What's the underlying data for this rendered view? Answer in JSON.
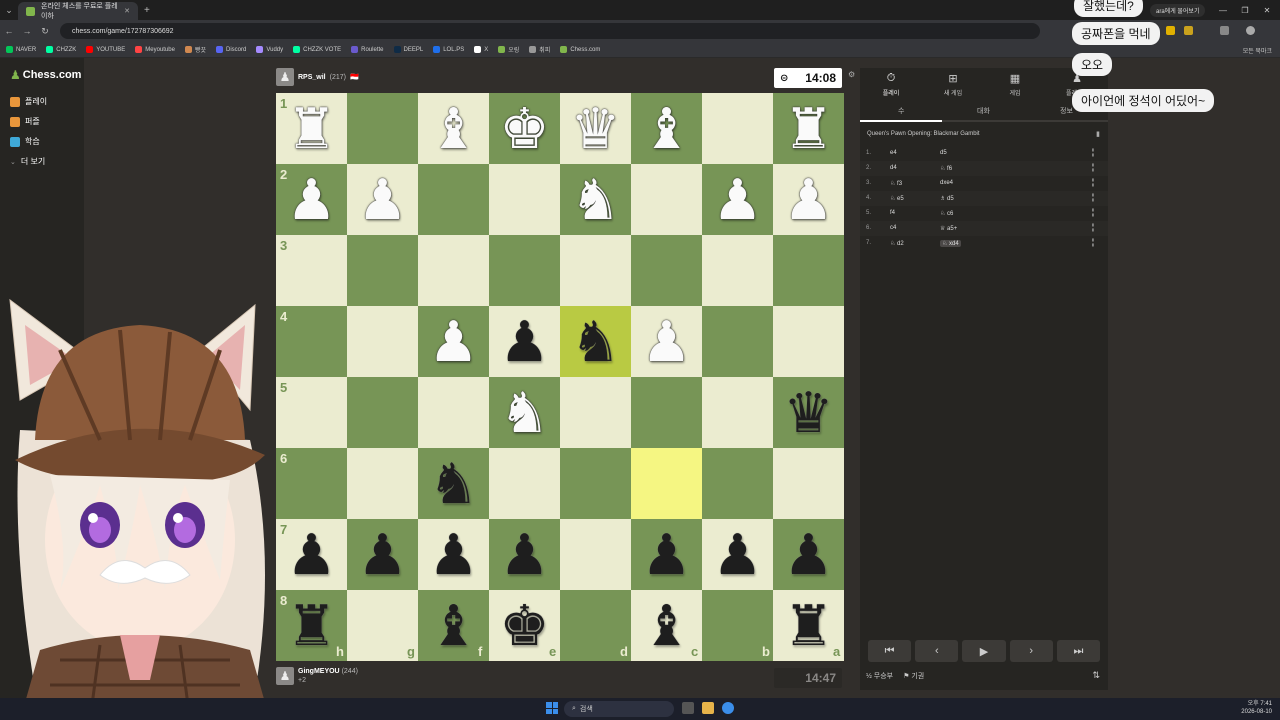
{
  "browser": {
    "tab_title": "온라인 체스를 무료로 플레이하",
    "url": "chess.com/game/172787306692",
    "bookmarks": [
      "NAVER",
      "CHZZK",
      "YOUTUBE",
      "Meyoutube",
      "빵끗",
      "Discord",
      "Vuddy",
      "CHZZK VOTE",
      "Roulette",
      "DEEPL",
      "LOL.PS",
      "X",
      "오링",
      "취피",
      "Chess.com"
    ],
    "bookmarks_right": "모든 북마크",
    "ext_button": "ara에게 물어보기"
  },
  "sidebar": {
    "logo": "Chess.com",
    "items": [
      {
        "label": "플레이",
        "color": "#e8963b"
      },
      {
        "label": "퍼즐",
        "color": "#e8963b"
      },
      {
        "label": "학습",
        "color": "#3fa9d8"
      },
      {
        "label": "더 보기",
        "color": "#999999"
      }
    ]
  },
  "top_player": {
    "name": "RPS_wil",
    "rating": "(217)",
    "flag": "🇮🇩"
  },
  "bottom_player": {
    "name": "GingMEYOU",
    "rating": "(244)",
    "sub": "+2"
  },
  "clocks": {
    "top": "14:08",
    "bottom": "14:47"
  },
  "board": {
    "ranks": [
      "1",
      "2",
      "3",
      "4",
      "5",
      "6",
      "7",
      "8"
    ],
    "files": [
      "h",
      "g",
      "f",
      "e",
      "d",
      "c",
      "b",
      "a"
    ],
    "pieces": [
      {
        "glyph": "♜",
        "color": "w",
        "row": 0,
        "col": 0
      },
      {
        "glyph": "♝",
        "color": "w",
        "row": 0,
        "col": 2
      },
      {
        "glyph": "♚",
        "color": "w",
        "row": 0,
        "col": 3
      },
      {
        "glyph": "♛",
        "color": "w",
        "row": 0,
        "col": 4
      },
      {
        "glyph": "♝",
        "color": "w",
        "row": 0,
        "col": 5
      },
      {
        "glyph": "♜",
        "color": "w",
        "row": 0,
        "col": 7
      },
      {
        "glyph": "♟",
        "color": "w",
        "row": 1,
        "col": 0
      },
      {
        "glyph": "♟",
        "color": "w",
        "row": 1,
        "col": 1
      },
      {
        "glyph": "♞",
        "color": "w",
        "row": 1,
        "col": 4
      },
      {
        "glyph": "♟",
        "color": "w",
        "row": 1,
        "col": 6
      },
      {
        "glyph": "♟",
        "color": "w",
        "row": 1,
        "col": 7
      },
      {
        "glyph": "♟",
        "color": "w",
        "row": 3,
        "col": 2
      },
      {
        "glyph": "♟",
        "color": "b",
        "row": 3,
        "col": 3
      },
      {
        "glyph": "♞",
        "color": "b",
        "row": 3,
        "col": 4
      },
      {
        "glyph": "♟",
        "color": "w",
        "row": 3,
        "col": 5
      },
      {
        "glyph": "♞",
        "color": "w",
        "row": 4,
        "col": 3
      },
      {
        "glyph": "♛",
        "color": "b",
        "row": 4,
        "col": 7
      },
      {
        "glyph": "♞",
        "color": "b",
        "row": 5,
        "col": 2
      },
      {
        "glyph": "♟",
        "color": "b",
        "row": 6,
        "col": 0
      },
      {
        "glyph": "♟",
        "color": "b",
        "row": 6,
        "col": 1
      },
      {
        "glyph": "♟",
        "color": "b",
        "row": 6,
        "col": 2
      },
      {
        "glyph": "♟",
        "color": "b",
        "row": 6,
        "col": 3
      },
      {
        "glyph": "♟",
        "color": "b",
        "row": 6,
        "col": 5
      },
      {
        "glyph": "♟",
        "color": "b",
        "row": 6,
        "col": 6
      },
      {
        "glyph": "♟",
        "color": "b",
        "row": 6,
        "col": 7
      },
      {
        "glyph": "♜",
        "color": "b",
        "row": 7,
        "col": 0
      },
      {
        "glyph": "♝",
        "color": "b",
        "row": 7,
        "col": 2
      },
      {
        "glyph": "♚",
        "color": "b",
        "row": 7,
        "col": 3
      },
      {
        "glyph": "♝",
        "color": "b",
        "row": 7,
        "col": 5
      },
      {
        "glyph": "♜",
        "color": "b",
        "row": 7,
        "col": 7
      }
    ],
    "highlights": [
      {
        "row": 3,
        "col": 4
      },
      {
        "row": 5,
        "col": 5
      }
    ]
  },
  "panel": {
    "tabs": [
      "플레이",
      "새 게임",
      "게임",
      "플레이어"
    ],
    "subtabs": [
      "수",
      "대화",
      "정보"
    ],
    "opening": "Queen's Pawn Opening: Blackmar Gambit",
    "moves": [
      {
        "n": "1.",
        "w": "e4",
        "b": "d5"
      },
      {
        "n": "2.",
        "w": "d4",
        "b": "♘ f6"
      },
      {
        "n": "3.",
        "w": "♘ f3",
        "b": "dxe4"
      },
      {
        "n": "4.",
        "w": "♘ e5",
        "b": "♗ d5"
      },
      {
        "n": "5.",
        "w": "f4",
        "b": "♘ c6"
      },
      {
        "n": "6.",
        "w": "c4",
        "b": "♕ a5+"
      },
      {
        "n": "7.",
        "w": "♘ d2",
        "b": "♘ xd4"
      }
    ],
    "footer": [
      "½ 무승부",
      "⚑ 기권"
    ]
  },
  "chat": [
    {
      "text": "잘했는데?"
    },
    {
      "text": "공짜폰을 먹네"
    },
    {
      "text": "오오"
    },
    {
      "text": "아이언에 정석이 어딨어~"
    }
  ],
  "taskbar": {
    "search": "검색",
    "time": "오후 7:41",
    "date": "2026-08-10"
  }
}
